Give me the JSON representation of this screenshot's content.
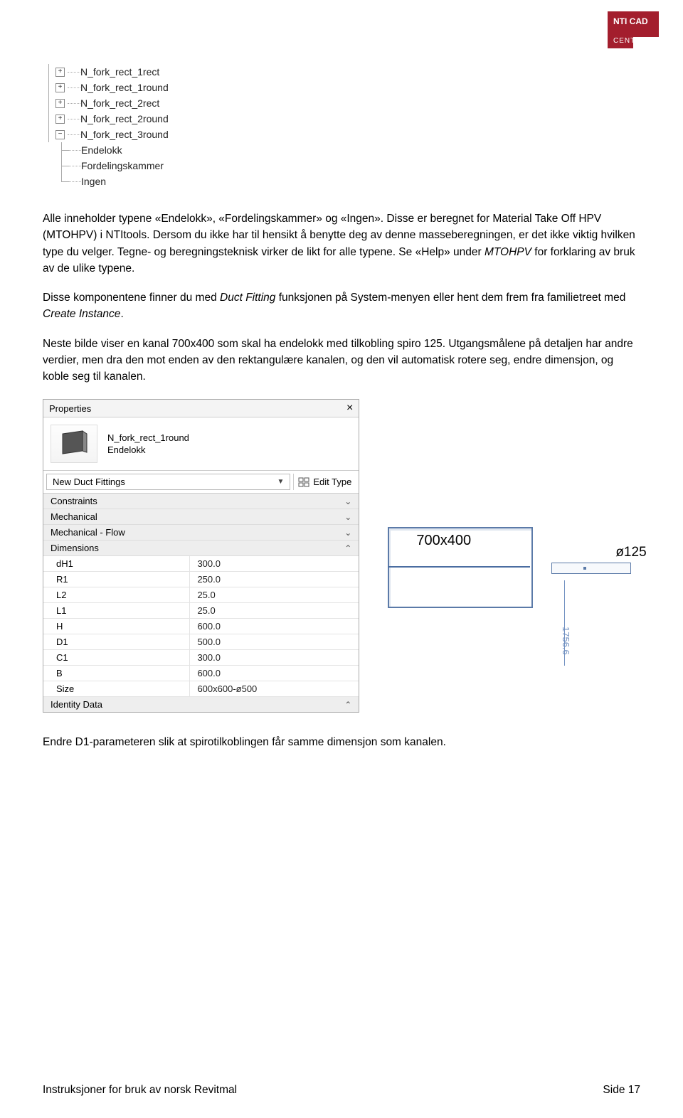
{
  "logo": {
    "line1": "NTI CAD",
    "line2": "CENTER"
  },
  "tree": {
    "items": [
      {
        "label": "N_fork_rect_1rect",
        "expander": "+",
        "depth": 0
      },
      {
        "label": "N_fork_rect_1round",
        "expander": "+",
        "depth": 0
      },
      {
        "label": "N_fork_rect_2rect",
        "expander": "+",
        "depth": 0
      },
      {
        "label": "N_fork_rect_2round",
        "expander": "+",
        "depth": 0
      },
      {
        "label": "N_fork_rect_3round",
        "expander": "−",
        "depth": 0
      },
      {
        "label": "Endelokk",
        "expander": "",
        "depth": 1
      },
      {
        "label": "Fordelingskammer",
        "expander": "",
        "depth": 1
      },
      {
        "label": "Ingen",
        "expander": "",
        "depth": 1,
        "last": true
      }
    ]
  },
  "paragraphs": {
    "p1a": "Alle inneholder typene «Endelokk», «Fordelingskammer» og «Ingen». Disse er beregnet for Material Take Off HPV (MTOHPV) i NTItools.",
    "p1b": "Dersom du ikke har til hensikt å benytte deg av denne masseberegningen, er det ikke viktig hvilken type du velger. Tegne- og beregningsteknisk virker de likt for alle typene. Se «Help» under ",
    "p1b_em": "MTOHPV",
    "p1b_tail": " for forklaring av bruk av de ulike typene.",
    "p2a": "Disse komponentene finner du med ",
    "p2a_em": "Duct Fitting",
    "p2a_mid": " funksjonen på System-menyen eller hent dem frem fra familietreet med ",
    "p2a_em2": "Create Instance",
    "p2a_tail": ".",
    "p3": "Neste bilde viser en kanal 700x400 som skal ha endelokk med tilkobling spiro 125. Utgangsmålene på detaljen har andre verdier, men dra den mot enden av den rektangulære kanalen, og den vil automatisk rotere seg, endre dimensjon, og koble seg til kanalen.",
    "p4": "Endre D1-parameteren slik at spirotilkoblingen får samme dimensjon som kanalen."
  },
  "props": {
    "title": "Properties",
    "family": {
      "name": "N_fork_rect_1round",
      "type": "Endelokk"
    },
    "selector": "New Duct Fittings",
    "edit_type": "Edit Type",
    "groups": [
      {
        "label": "Constraints",
        "state": "collapsed"
      },
      {
        "label": "Mechanical",
        "state": "collapsed"
      },
      {
        "label": "Mechanical - Flow",
        "state": "collapsed"
      },
      {
        "label": "Dimensions",
        "state": "expanded"
      }
    ],
    "params": [
      {
        "name": "dH1",
        "value": "300.0"
      },
      {
        "name": "R1",
        "value": "250.0"
      },
      {
        "name": "L2",
        "value": "25.0"
      },
      {
        "name": "L1",
        "value": "25.0"
      },
      {
        "name": "H",
        "value": "600.0"
      },
      {
        "name": "D1",
        "value": "500.0"
      },
      {
        "name": "C1",
        "value": "300.0"
      },
      {
        "name": "B",
        "value": "600.0"
      },
      {
        "name": "Size",
        "value": "600x600-ø500"
      }
    ],
    "identity_label": "Identity Data"
  },
  "diagram": {
    "duct_label": "700x400",
    "spiro_dia": "ø125",
    "dim_val": "1756.6"
  },
  "footer": {
    "left": "Instruksjoner for bruk av norsk Revitmal",
    "right": "Side 17"
  }
}
